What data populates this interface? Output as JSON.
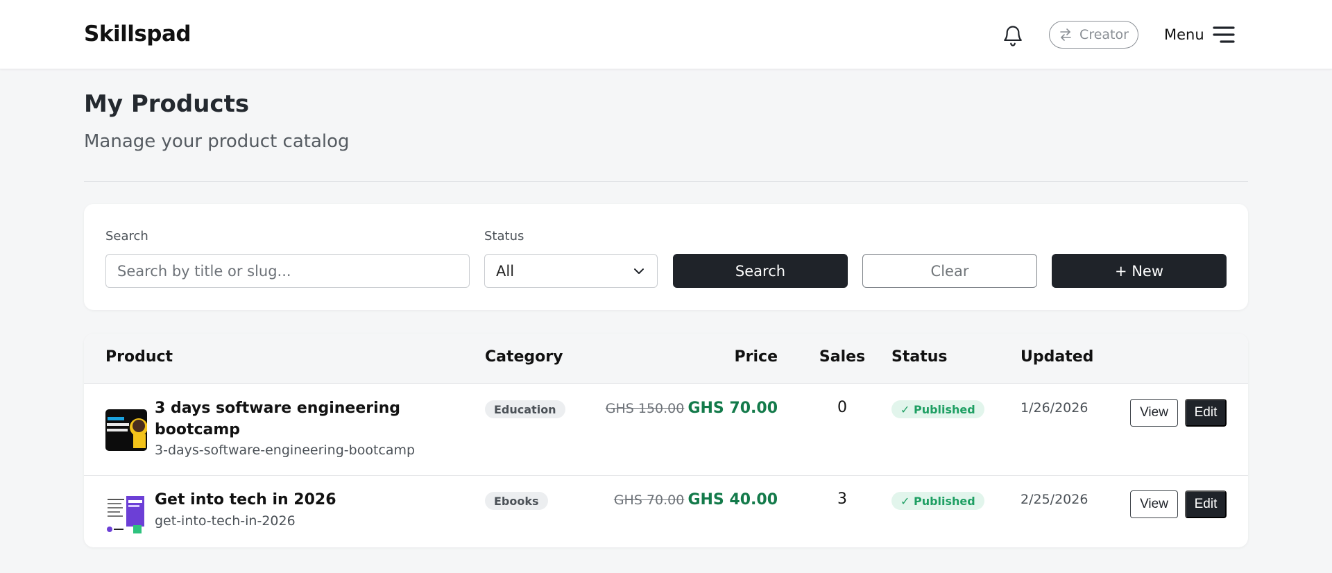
{
  "header": {
    "logo": "Skillspad",
    "creator_label": "Creator",
    "menu_label": "Menu",
    "icons": {
      "notifications": "bell-icon",
      "switch": "swap-arrows-icon",
      "menu": "hamburger-icon"
    }
  },
  "page": {
    "title": "My Products",
    "subtitle": "Manage your product catalog"
  },
  "filters": {
    "search_label": "Search",
    "search_placeholder": "Search by title or slug...",
    "search_value": "",
    "status_label": "Status",
    "status_value": "All",
    "search_button": "Search",
    "clear_button": "Clear",
    "new_button": "+ New"
  },
  "table": {
    "columns": {
      "product": "Product",
      "category": "Category",
      "price": "Price",
      "sales": "Sales",
      "status": "Status",
      "updated": "Updated"
    },
    "rows": [
      {
        "title": "3 days software engineering bootcamp",
        "slug": "3-days-software-engineering-bootcamp",
        "category": "Education",
        "old_price": "GHS 150.00",
        "new_price": "GHS 70.00",
        "sales": "0",
        "status": "✓ Published",
        "updated": "1/26/2026",
        "view_label": "View",
        "edit_label": "Edit"
      },
      {
        "title": "Get into tech in 2026",
        "slug": "get-into-tech-in-2026",
        "category": "Ebooks",
        "old_price": "GHS 70.00",
        "new_price": "GHS 40.00",
        "sales": "3",
        "status": "✓ Published",
        "updated": "2/25/2026",
        "view_label": "View",
        "edit_label": "Edit"
      }
    ]
  },
  "colors": {
    "accent_dark": "#1f2329",
    "price_green": "#137a4a",
    "published_green": "#1e9f63",
    "published_bg": "#e2f5ec"
  }
}
